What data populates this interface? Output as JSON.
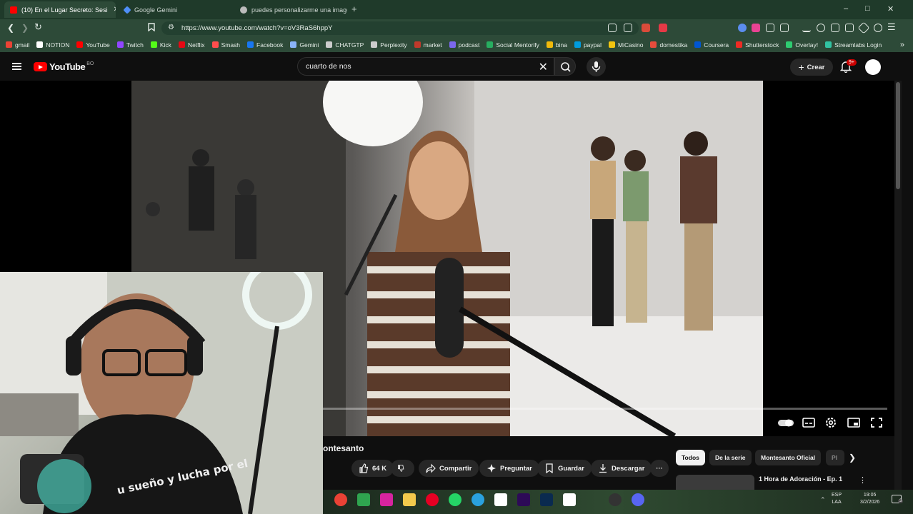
{
  "browser": {
    "tabs": [
      {
        "title": "(10) En el Lugar Secreto: Sesi",
        "active": true
      },
      {
        "title": "Google Gemini",
        "active": false
      },
      {
        "title": "puedes personalizarme una imagen",
        "active": false
      }
    ],
    "new_tab": "+",
    "window_controls": {
      "minimize": "–",
      "maximize": "□",
      "close": "✕"
    },
    "url": "https://www.youtube.com/watch?v=oV3RaS6hppY",
    "bookmarks": [
      {
        "label": "gmail",
        "color": "#ea4335"
      },
      {
        "label": "NOTION",
        "color": "#ffffff"
      },
      {
        "label": "YouTube",
        "color": "#ff0000"
      },
      {
        "label": "Twitch",
        "color": "#9146ff"
      },
      {
        "label": "Kick",
        "color": "#53fc18"
      },
      {
        "label": "Netflix",
        "color": "#e50914"
      },
      {
        "label": "Smash",
        "color": "#ff4d4d"
      },
      {
        "label": "Facebook",
        "color": "#1877f2"
      },
      {
        "label": "Gemini",
        "color": "#8ab4f8"
      },
      {
        "label": "CHATGTP",
        "color": "#cccccc"
      },
      {
        "label": "Perplexity",
        "color": "#cccccc"
      },
      {
        "label": "market",
        "color": "#c0392b"
      },
      {
        "label": "podcast",
        "color": "#7b68ee"
      },
      {
        "label": "Social Mentorify",
        "color": "#27ae60"
      },
      {
        "label": "bina",
        "color": "#f0b90b"
      },
      {
        "label": "paypal",
        "color": "#009cde"
      },
      {
        "label": "MiCasino",
        "color": "#f1c40f"
      },
      {
        "label": "domestika",
        "color": "#e74c3c"
      },
      {
        "label": "Coursera",
        "color": "#0056d2"
      },
      {
        "label": "Shutterstock",
        "color": "#ee2b24"
      },
      {
        "label": "Overlay!",
        "color": "#2ecc71"
      },
      {
        "label": "Streamlabs Login",
        "color": "#31c3a2"
      }
    ],
    "bookmarks_more": "»"
  },
  "youtube": {
    "logo_text": "YouTube",
    "country_code": "BO",
    "search_query": "cuarto de nos",
    "create_label": "Crear",
    "notifications_badge": "9+",
    "video_title_partial": "ontesanto",
    "actions": {
      "likes": "64 K",
      "share": "Compartir",
      "ask": "Preguntar",
      "save": "Guardar",
      "download": "Descargar",
      "more": "···"
    },
    "chips": [
      "Todos",
      "De la serie",
      "Montesanto Oficial",
      "Pl"
    ],
    "recommendation_title": "1 Hora de Adoración - Ep. 1",
    "webcam_shirt_text": "u sueño y lucha por el"
  },
  "taskbar": {
    "language": "ESP",
    "layout": "LAA",
    "time": "19:05",
    "date": "3/2/2026",
    "notifications": "3"
  }
}
